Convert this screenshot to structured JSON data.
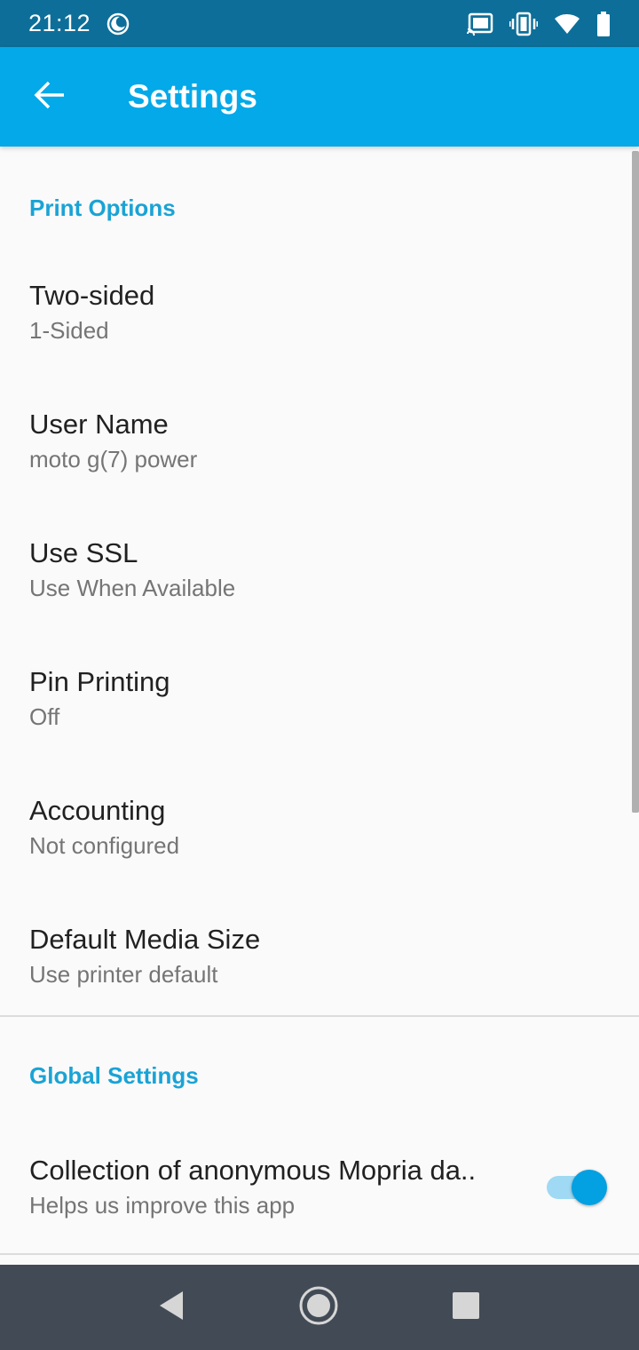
{
  "status_bar": {
    "time": "21:12",
    "icons": [
      "moon-icon",
      "cast-icon",
      "vibrate-icon",
      "wifi-icon",
      "battery-icon"
    ]
  },
  "app_bar": {
    "title": "Settings",
    "back_icon": "arrow-back-icon",
    "color": "#03a9e8"
  },
  "print_options": {
    "header": "Print Options",
    "items": [
      {
        "title": "Two-sided",
        "summary": "1-Sided"
      },
      {
        "title": "User Name",
        "summary": "moto g(7) power"
      },
      {
        "title": "Use SSL",
        "summary": "Use When Available"
      },
      {
        "title": "Pin Printing",
        "summary": "Off"
      },
      {
        "title": "Accounting",
        "summary": "Not configured"
      },
      {
        "title": "Default Media Size",
        "summary": "Use printer default"
      }
    ]
  },
  "global_settings": {
    "header": "Global Settings",
    "items": [
      {
        "title": "Collection of anonymous Mopria da..",
        "summary": "Helps us improve this app",
        "toggle_on": true
      }
    ]
  },
  "nav_bar": {
    "icons": [
      "nav-back-icon",
      "nav-home-icon",
      "nav-recents-icon"
    ]
  },
  "colors": {
    "accent": "#1aa3d5",
    "status_bar": "#0d6f99",
    "nav_bar": "#424b55"
  }
}
